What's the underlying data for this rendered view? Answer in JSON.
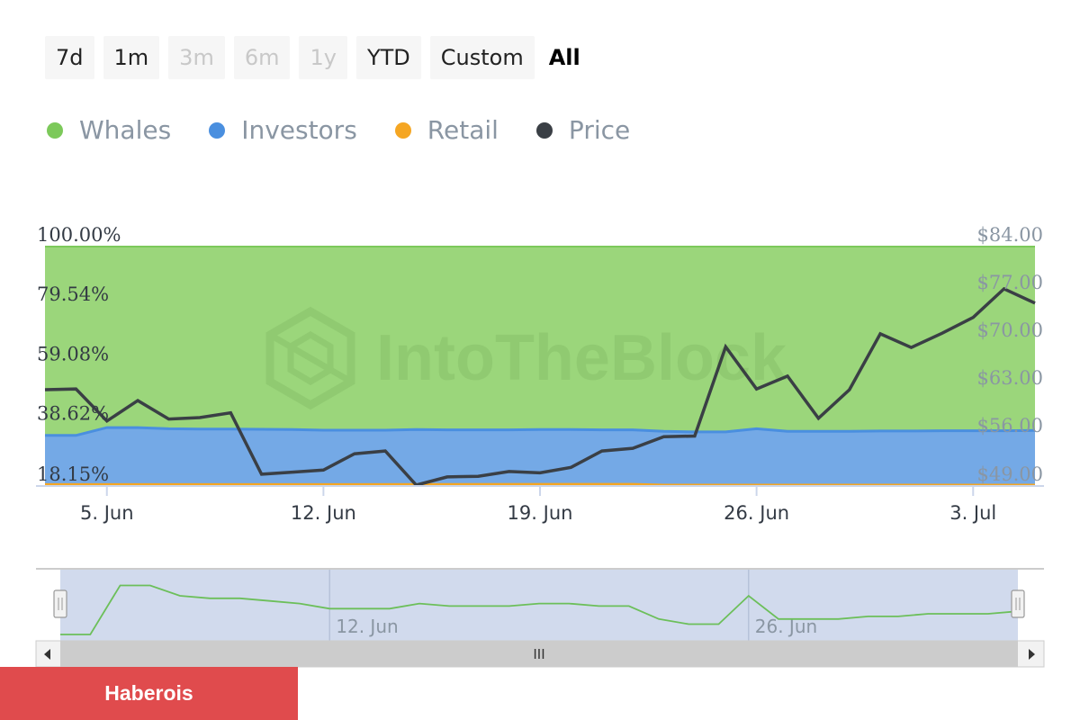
{
  "range_selector": {
    "buttons": [
      {
        "label": "7d",
        "state": "normal"
      },
      {
        "label": "1m",
        "state": "normal"
      },
      {
        "label": "3m",
        "state": "disabled"
      },
      {
        "label": "6m",
        "state": "disabled"
      },
      {
        "label": "1y",
        "state": "disabled"
      },
      {
        "label": "YTD",
        "state": "normal"
      },
      {
        "label": "Custom",
        "state": "normal"
      },
      {
        "label": "All",
        "state": "selected"
      }
    ]
  },
  "watermark": "IntoTheBlock",
  "footer": {
    "badge_label": "Haberois"
  },
  "colors": {
    "whales": "#9bd67b",
    "whales_line": "#7cc95a",
    "investors": "#74a9e6",
    "investors_line": "#4a8fdf",
    "retail": "#f5a623",
    "price": "#3a3f45"
  },
  "chart_data": {
    "type": "area",
    "stacking": "percent",
    "legend": {
      "placement": "top-left",
      "items": [
        {
          "name": "Whales",
          "color": "#7cc95a"
        },
        {
          "name": "Investors",
          "color": "#4a8fdf"
        },
        {
          "name": "Retail",
          "color": "#f5a623"
        },
        {
          "name": "Price",
          "color": "#3a3f45"
        }
      ]
    },
    "x_start": "2023-06-03",
    "x_end": "2023-07-05",
    "x_ticks": [
      "5. Jun",
      "12. Jun",
      "19. Jun",
      "26. Jun",
      "3. Jul"
    ],
    "y_left": {
      "ticks": [
        "18.15%",
        "38.62%",
        "59.08%",
        "79.54%",
        "100.00%"
      ],
      "range": [
        18.15,
        100
      ]
    },
    "y_right": {
      "ticks": [
        "$49.00",
        "$56.00",
        "$63.00",
        "$70.00",
        "$77.00",
        "$84.00"
      ],
      "range": [
        49,
        84
      ]
    },
    "series": [
      {
        "name": "Investors",
        "axis": "left",
        "x": [
          "2023-06-03",
          "2023-06-04",
          "2023-06-05",
          "2023-06-06",
          "2023-06-07",
          "2023-06-08",
          "2023-06-09",
          "2023-06-10",
          "2023-06-11",
          "2023-06-12",
          "2023-06-13",
          "2023-06-14",
          "2023-06-15",
          "2023-06-16",
          "2023-06-17",
          "2023-06-18",
          "2023-06-19",
          "2023-06-20",
          "2023-06-21",
          "2023-06-22",
          "2023-06-23",
          "2023-06-24",
          "2023-06-25",
          "2023-06-26",
          "2023-06-27",
          "2023-06-28",
          "2023-06-29",
          "2023-06-30",
          "2023-07-01",
          "2023-07-02",
          "2023-07-03",
          "2023-07-04",
          "2023-07-05"
        ],
        "values": [
          35.2,
          35.2,
          37.9,
          37.9,
          37.5,
          37.4,
          37.4,
          37.3,
          37.2,
          37.0,
          37.0,
          37.0,
          37.2,
          37.1,
          37.1,
          37.1,
          37.2,
          37.2,
          37.1,
          37.1,
          36.6,
          36.4,
          36.4,
          37.5,
          36.6,
          36.6,
          36.6,
          36.7,
          36.7,
          36.8,
          36.8,
          36.8,
          36.9
        ]
      },
      {
        "name": "Retail",
        "axis": "left",
        "x": [
          "2023-06-03",
          "2023-06-13",
          "2023-06-20",
          "2023-06-22",
          "2023-06-23",
          "2023-07-05"
        ],
        "values": [
          18.8,
          18.8,
          18.9,
          18.9,
          18.6,
          18.6
        ]
      },
      {
        "name": "Price",
        "axis": "right",
        "type": "line",
        "x": [
          "2023-06-03",
          "2023-06-04",
          "2023-06-05",
          "2023-06-06",
          "2023-06-07",
          "2023-06-08",
          "2023-06-09",
          "2023-06-10",
          "2023-06-11",
          "2023-06-12",
          "2023-06-13",
          "2023-06-14",
          "2023-06-15",
          "2023-06-16",
          "2023-06-17",
          "2023-06-18",
          "2023-06-19",
          "2023-06-20",
          "2023-06-21",
          "2023-06-22",
          "2023-06-23",
          "2023-06-24",
          "2023-06-25",
          "2023-06-26",
          "2023-06-27",
          "2023-06-28",
          "2023-06-29",
          "2023-06-30",
          "2023-07-01",
          "2023-07-02",
          "2023-07-03",
          "2023-07-04",
          "2023-07-05"
        ],
        "values": [
          63.0,
          63.1,
          58.4,
          61.4,
          58.7,
          58.9,
          59.6,
          50.6,
          50.9,
          51.2,
          53.6,
          54.0,
          49.0,
          50.2,
          50.3,
          51.0,
          50.8,
          51.6,
          54.0,
          54.4,
          56.1,
          56.2,
          69.3,
          63.1,
          65.0,
          58.8,
          63.0,
          71.2,
          69.2,
          71.3,
          73.6,
          77.8,
          75.7
        ]
      }
    ]
  },
  "navigator": {
    "x_ticks": [
      "12. Jun",
      "26. Jun"
    ],
    "scrollbar_grip": "III"
  }
}
